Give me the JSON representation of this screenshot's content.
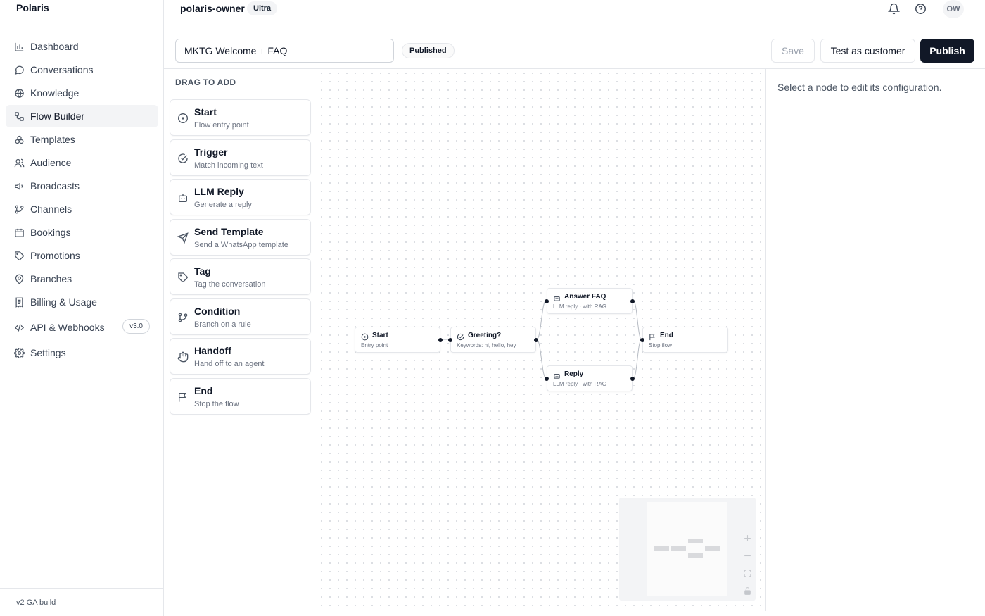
{
  "app": {
    "brand": "Polaris",
    "build": "v2 GA build"
  },
  "sidebar": {
    "items": [
      {
        "label": "Dashboard",
        "icon": "bar-chart-icon"
      },
      {
        "label": "Conversations",
        "icon": "message-circle-icon"
      },
      {
        "label": "Knowledge",
        "icon": "globe-book-icon"
      },
      {
        "label": "Flow Builder",
        "icon": "workflow-icon",
        "active": true
      },
      {
        "label": "Templates",
        "icon": "shapes-icon"
      },
      {
        "label": "Audience",
        "icon": "users-icon"
      },
      {
        "label": "Broadcasts",
        "icon": "megaphone-icon"
      },
      {
        "label": "Channels",
        "icon": "git-branch-icon"
      },
      {
        "label": "Bookings",
        "icon": "calendar-icon"
      },
      {
        "label": "Promotions",
        "icon": "tag-icon"
      },
      {
        "label": "Branches",
        "icon": "map-pin-icon"
      },
      {
        "label": "Billing & Usage",
        "icon": "receipt-icon"
      },
      {
        "label": "API & Webhooks",
        "icon": "code-icon",
        "badge": "v3.0"
      },
      {
        "label": "Settings",
        "icon": "gear-icon"
      }
    ]
  },
  "header": {
    "org": "polaris-owner",
    "plan": "Ultra",
    "avatar": "OW"
  },
  "toolbar": {
    "flow_name": "MKTG Welcome + FAQ",
    "status": "Published",
    "save_label": "Save",
    "test_label": "Test as customer",
    "publish_label": "Publish"
  },
  "palette": {
    "heading": "DRAG TO ADD",
    "items": [
      {
        "title": "Start",
        "subtitle": "Flow entry point",
        "icon": "play-circle-icon"
      },
      {
        "title": "Trigger",
        "subtitle": "Match incoming text",
        "icon": "check-circle-icon"
      },
      {
        "title": "LLM Reply",
        "subtitle": "Generate a reply",
        "icon": "bot-icon"
      },
      {
        "title": "Send Template",
        "subtitle": "Send a WhatsApp template",
        "icon": "send-icon"
      },
      {
        "title": "Tag",
        "subtitle": "Tag the conversation",
        "icon": "tag-icon"
      },
      {
        "title": "Condition",
        "subtitle": "Branch on a rule",
        "icon": "git-branch-icon"
      },
      {
        "title": "Handoff",
        "subtitle": "Hand off to an agent",
        "icon": "hand-icon"
      },
      {
        "title": "End",
        "subtitle": "Stop the flow",
        "icon": "flag-icon"
      }
    ]
  },
  "canvas": {
    "nodes": [
      {
        "id": "start",
        "title": "Start",
        "subtitle": "Entry point",
        "icon": "play-circle-icon"
      },
      {
        "id": "greeting",
        "title": "Greeting?",
        "subtitle": "Keywords: hi, hello, hey",
        "icon": "check-circle-icon"
      },
      {
        "id": "answer",
        "title": "Answer FAQ",
        "subtitle": "LLM reply · with RAG",
        "icon": "bot-icon"
      },
      {
        "id": "reply",
        "title": "Reply",
        "subtitle": "LLM reply · with RAG",
        "icon": "bot-icon"
      },
      {
        "id": "end",
        "title": "End",
        "subtitle": "Stop flow",
        "icon": "flag-icon"
      }
    ]
  },
  "config": {
    "hint": "Select a node to edit its configuration."
  }
}
